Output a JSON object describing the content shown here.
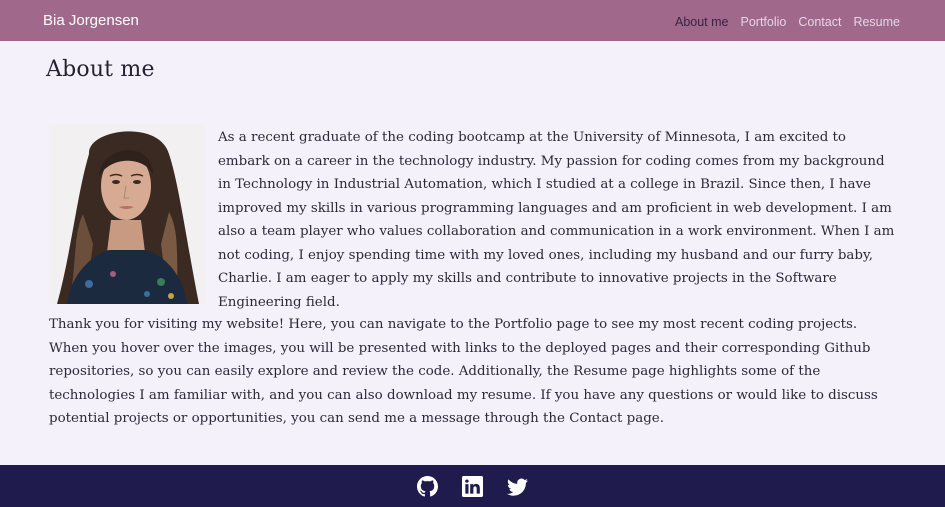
{
  "navbar": {
    "brand": "Bia Jorgensen",
    "links": [
      {
        "label": "About me",
        "active": true
      },
      {
        "label": "Portfolio",
        "active": false
      },
      {
        "label": "Contact",
        "active": false
      },
      {
        "label": "Resume",
        "active": false
      }
    ]
  },
  "main": {
    "title": "About me",
    "paragraph_1": "As a recent graduate of the coding bootcamp at the University of Minnesota, I am excited to embark on a career in the technology industry. My passion for coding comes from my background in Technology in Industrial Automation, which I studied at a college in Brazil. Since then, I have improved my skills in various programming languages and am proficient in web development. I am also a team player who values collaboration and communication in a work environment. When I am not coding, I enjoy spending time with my loved ones, including my husband and our furry baby, Charlie. I am eager to apply my skills and contribute to innovative projects in the Software Engineering field.",
    "paragraph_2": "Thank you for visiting my website! Here, you can navigate to the Portfolio page to see my most recent coding projects. When you hover over the images, you will be presented with links to the deployed pages and their corresponding Github repositories, so you can easily explore and review the code. Additionally, the Resume page highlights some of the technologies I am familiar with, and you can also download my resume. If you have any questions or would like to discuss potential projects or opportunities, you can send me a message through the Contact page."
  },
  "footer": {
    "icons": [
      "github-icon",
      "linkedin-icon",
      "twitter-icon"
    ]
  },
  "colors": {
    "navbar_bg": "#a0688a",
    "page_bg": "#f5f1fb",
    "footer_bg": "#1f1b4d",
    "active_link": "#3a2346"
  }
}
